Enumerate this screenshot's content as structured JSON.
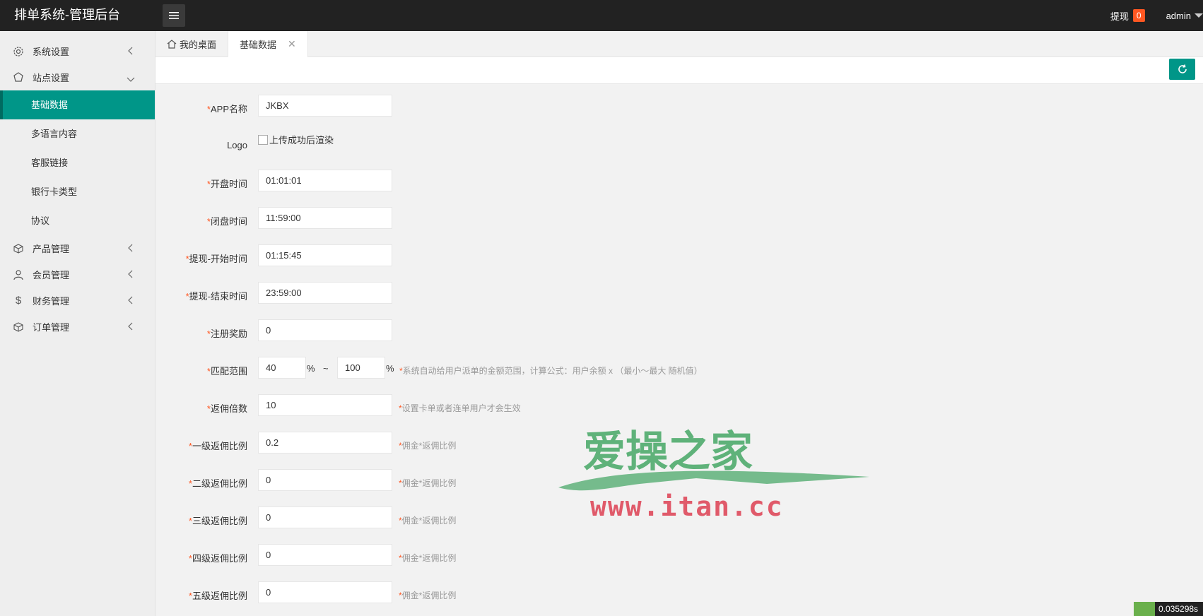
{
  "header": {
    "title": "排单系统-管理后台",
    "withdraw_label": "提现",
    "withdraw_count": "0",
    "user": "admin"
  },
  "sidebar": {
    "items": [
      {
        "label": "系统设置",
        "icon": "gear-icon"
      },
      {
        "label": "站点设置",
        "icon": "site-icon",
        "expanded": true,
        "children": [
          "基础数据",
          "多语言内容",
          "客服链接",
          "银行卡类型",
          "协议"
        ]
      },
      {
        "label": "产品管理",
        "icon": "cube-icon"
      },
      {
        "label": "会员管理",
        "icon": "user-icon"
      },
      {
        "label": "财务管理",
        "icon": "dollar-icon"
      },
      {
        "label": "订单管理",
        "icon": "box-icon"
      }
    ],
    "active_child": "基础数据"
  },
  "tabs": [
    {
      "label": "我的桌面"
    },
    {
      "label": "基础数据",
      "close": "✕"
    }
  ],
  "form": {
    "app_name": {
      "label": "APP名称",
      "value": "JKBX"
    },
    "logo": {
      "label": "Logo",
      "alt": "上传成功后渲染"
    },
    "open_time": {
      "label": "开盘时间",
      "value": "01:01:01"
    },
    "close_time": {
      "label": "闭盘时间",
      "value": "11:59:00"
    },
    "wd_start": {
      "label": "提现-开始时间",
      "value": "01:15:45"
    },
    "wd_end": {
      "label": "提现-结束时间",
      "value": "23:59:00"
    },
    "reg_reward": {
      "label": "注册奖励",
      "value": "0"
    },
    "match_range": {
      "label": "匹配范围",
      "min": "40",
      "max": "100",
      "pct": "%",
      "tilde": "~",
      "hint": "系统自动给用户派单的金额范围，计算公式：用户余额 x （最小～最大 随机值）"
    },
    "commission_mult": {
      "label": "返佣倍数",
      "value": "10",
      "hint": "设置卡单或者连单用户才会生效"
    },
    "level1": {
      "label": "一级返佣比例",
      "value": "0.2",
      "hint": "佣金*返佣比例"
    },
    "level2": {
      "label": "二级返佣比例",
      "value": "0",
      "hint": "佣金*返佣比例"
    },
    "level3": {
      "label": "三级返佣比例",
      "value": "0",
      "hint": "佣金*返佣比例"
    },
    "level4": {
      "label": "四级返佣比例",
      "value": "0",
      "hint": "佣金*返佣比例"
    },
    "level5": {
      "label": "五级返佣比例",
      "value": "0",
      "hint": "佣金*返佣比例"
    }
  },
  "watermark": {
    "text": "爱操之家",
    "url": "www.itan.cc"
  },
  "corner_text": "0.035298s",
  "colors": {
    "accent": "#009688",
    "topbar": "#222222",
    "badge": "#FF5722"
  }
}
